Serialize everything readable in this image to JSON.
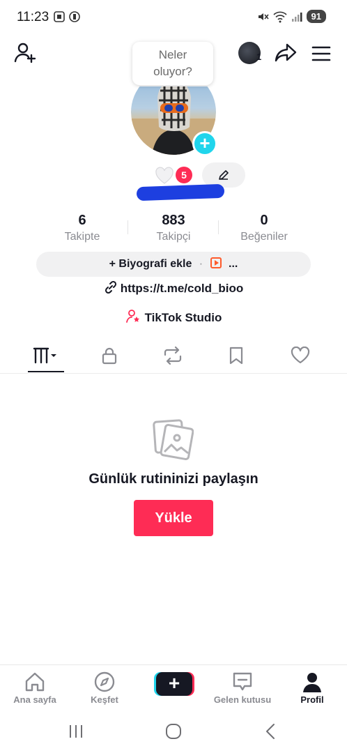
{
  "status_bar": {
    "time": "11:23",
    "battery": "91"
  },
  "header": {
    "avatar_count": "1",
    "bubble_line1": "Neler",
    "bubble_line2": "oluyor?"
  },
  "profile": {
    "notification_count": "5"
  },
  "stats": [
    {
      "value": "6",
      "label": "Takipte"
    },
    {
      "value": "883",
      "label": "Takipçi"
    },
    {
      "value": "0",
      "label": "Beğeniler"
    }
  ],
  "bio": {
    "add_label": "+ Biyografi ekle",
    "separator": "·",
    "more": "..."
  },
  "link": "https://t.me/cold_bioo",
  "studio": "TikTok Studio",
  "tabs": [
    {
      "icon": "videos-grid-icon",
      "active": true
    },
    {
      "icon": "lock-icon"
    },
    {
      "icon": "repost-icon"
    },
    {
      "icon": "bookmark-icon"
    },
    {
      "icon": "heart-icon"
    }
  ],
  "empty_state": {
    "title": "Günlük rutininizi paylaşın",
    "button": "Yükle"
  },
  "bottom_nav": [
    {
      "label": "Ana sayfa",
      "icon": "home-icon"
    },
    {
      "label": "Keşfet",
      "icon": "compass-icon"
    },
    {
      "label": "",
      "icon": "plus-icon"
    },
    {
      "label": "Gelen kutusu",
      "icon": "inbox-icon"
    },
    {
      "label": "Profil",
      "icon": "profile-icon",
      "active": true
    }
  ],
  "colors": {
    "accent": "#fe2c55",
    "cyan": "#20d5ec",
    "text": "#161823",
    "muted": "#8a8b91"
  }
}
